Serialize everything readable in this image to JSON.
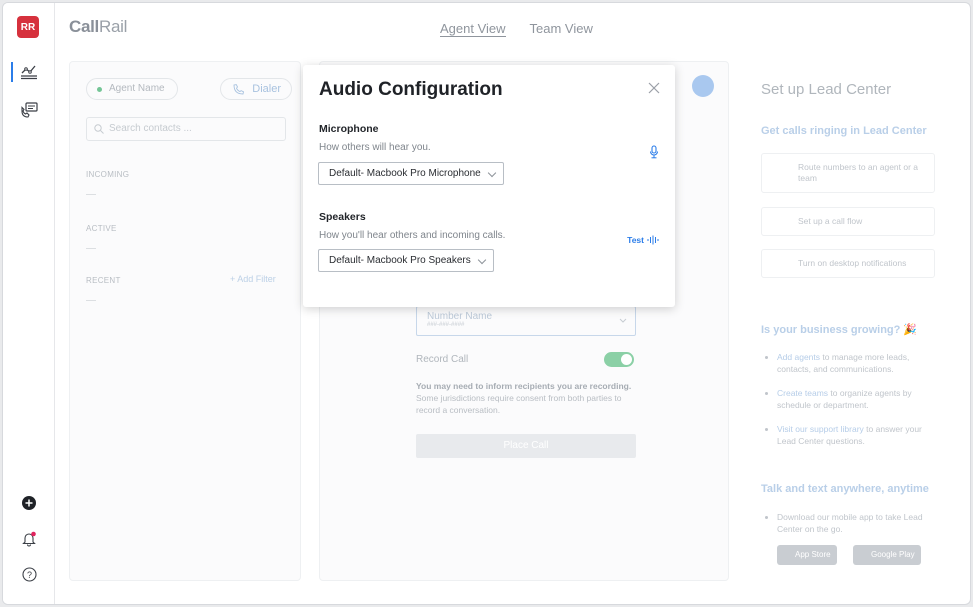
{
  "rail": {
    "avatar": "RR"
  },
  "topbar": {
    "logo_bold": "Call",
    "logo_light": "Rail",
    "tabs": [
      "Agent View",
      "Team View"
    ]
  },
  "left_panel": {
    "agent_name": "Agent Name",
    "dialer": "Dialer",
    "search_placeholder": "Search contacts ...",
    "incoming": "INCOMING",
    "active": "ACTIVE",
    "recent": "RECENT",
    "add_filter": "+ Add Filter"
  },
  "dialer_panel": {
    "number_name": "Number Name",
    "number_format": "###-###-####",
    "record_call": "Record Call",
    "record_note_bold": "You may need to inform recipients you are recording.",
    "record_note": "Some jurisdictions require consent from both parties to record a conversation.",
    "place_call": "Place Call",
    "record_enabled": true
  },
  "lead_center": {
    "title": "Set up Lead Center",
    "calls_heading": "Get calls ringing in Lead Center",
    "cards": [
      "Route numbers to an agent or a team",
      "Set up a call flow",
      "Turn on desktop notifications"
    ],
    "growing_heading": "Is your business growing? 🎉",
    "bullets": [
      {
        "link": "Add agents",
        "text": " to manage more leads, contacts, and communications."
      },
      {
        "link": "Create teams",
        "text": " to organize agents by schedule or department."
      },
      {
        "link": "Visit our support library",
        "text": " to answer your Lead Center questions."
      }
    ],
    "anywhere_heading": "Talk and text anywhere, anytime",
    "app_bullet": "Download our mobile app to take Lead Center on the go.",
    "app_store": "App Store",
    "google_play": "Google Play"
  },
  "modal": {
    "title": "Audio Configuration",
    "microphone_label": "Microphone",
    "microphone_help": "How others will hear you.",
    "microphone_value": "Default- Macbook Pro Microphone",
    "speakers_label": "Speakers",
    "speakers_help": "How you'll hear others and incoming calls.",
    "speakers_value": "Default- Macbook Pro Speakers",
    "test_label": "Test"
  },
  "colors": {
    "accent": "#2b7de9",
    "avatar_bg": "#d6313d",
    "toggle_on": "#8bd0a6"
  }
}
